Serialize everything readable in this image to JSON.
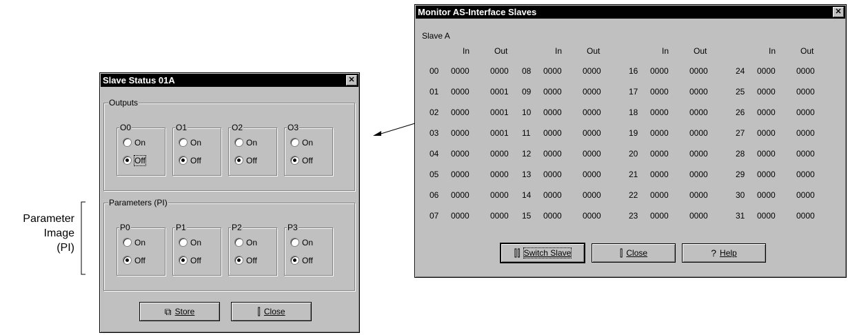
{
  "annotation": {
    "lines": [
      "Parameter",
      "Image",
      "(PI)"
    ]
  },
  "slave_status": {
    "title": "Slave Status  01A",
    "close_icon": "close-icon",
    "outputs": {
      "label": "Outputs",
      "groups": [
        {
          "name": "O0",
          "on": "On",
          "off": "Off",
          "selected": "off"
        },
        {
          "name": "O1",
          "on": "On",
          "off": "Off",
          "selected": "off"
        },
        {
          "name": "O2",
          "on": "On",
          "off": "Off",
          "selected": "off"
        },
        {
          "name": "O3",
          "on": "On",
          "off": "Off",
          "selected": "off"
        }
      ]
    },
    "parameters": {
      "label": "Parameters (PI)",
      "groups": [
        {
          "name": "P0",
          "on": "On",
          "off": "Off",
          "selected": "off"
        },
        {
          "name": "P1",
          "on": "On",
          "off": "Off",
          "selected": "off"
        },
        {
          "name": "P2",
          "on": "On",
          "off": "Off",
          "selected": "off"
        },
        {
          "name": "P3",
          "on": "On",
          "off": "Off",
          "selected": "off"
        }
      ]
    },
    "store_label": "Store",
    "close_label": "Close"
  },
  "monitor": {
    "title": "Monitor AS-Interface Slaves",
    "slave_label": "Slave A",
    "col_in": "In",
    "col_out": "Out",
    "rows": [
      [
        [
          "00",
          "0000",
          "0000"
        ],
        [
          "08",
          "0000",
          "0000"
        ],
        [
          "16",
          "0000",
          "0000"
        ],
        [
          "24",
          "0000",
          "0000"
        ]
      ],
      [
        [
          "01",
          "0000",
          "0001"
        ],
        [
          "09",
          "0000",
          "0000"
        ],
        [
          "17",
          "0000",
          "0000"
        ],
        [
          "25",
          "0000",
          "0000"
        ]
      ],
      [
        [
          "02",
          "0000",
          "0001"
        ],
        [
          "10",
          "0000",
          "0000"
        ],
        [
          "18",
          "0000",
          "0000"
        ],
        [
          "26",
          "0000",
          "0000"
        ]
      ],
      [
        [
          "03",
          "0000",
          "0001"
        ],
        [
          "11",
          "0000",
          "0000"
        ],
        [
          "19",
          "0000",
          "0000"
        ],
        [
          "27",
          "0000",
          "0000"
        ]
      ],
      [
        [
          "04",
          "0000",
          "0000"
        ],
        [
          "12",
          "0000",
          "0000"
        ],
        [
          "20",
          "0000",
          "0000"
        ],
        [
          "28",
          "0000",
          "0000"
        ]
      ],
      [
        [
          "05",
          "0000",
          "0000"
        ],
        [
          "13",
          "0000",
          "0000"
        ],
        [
          "21",
          "0000",
          "0000"
        ],
        [
          "29",
          "0000",
          "0000"
        ]
      ],
      [
        [
          "06",
          "0000",
          "0000"
        ],
        [
          "14",
          "0000",
          "0000"
        ],
        [
          "22",
          "0000",
          "0000"
        ],
        [
          "30",
          "0000",
          "0000"
        ]
      ],
      [
        [
          "07",
          "0000",
          "0000"
        ],
        [
          "15",
          "0000",
          "0000"
        ],
        [
          "23",
          "0000",
          "0000"
        ],
        [
          "31",
          "0000",
          "0000"
        ]
      ]
    ],
    "switch_label": "Switch Slave",
    "close_label": "Close",
    "help_label": "Help"
  }
}
